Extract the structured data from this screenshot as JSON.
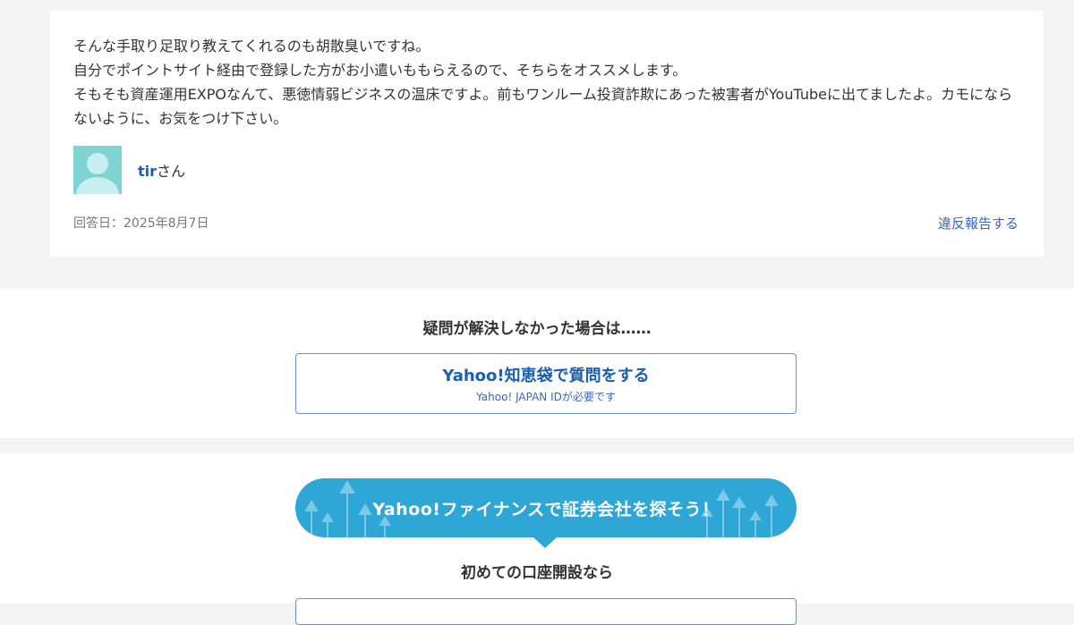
{
  "answer": {
    "lines": [
      "そんな手取り足取り教えてくれるのも胡散臭いですね。",
      "自分でポイントサイト経由で登録した方がお小遣いももらえるので、そちらをオススメします。",
      "そもそも資産運用EXPOなんて、悪徳情弱ビジネスの温床ですよ。前もワンルーム投資詐欺にあった被害者がYouTubeに出てましたよ。カモにならないように、お気をつけ下さい。"
    ],
    "author_id": "tir",
    "author_suffix": "さん",
    "date": "回答日：2025年8月7日",
    "report_label": "違反報告する"
  },
  "resolve": {
    "title": "疑問が解決しなかった場合は……",
    "ask_label": "Yahoo!知恵袋で質問をする",
    "ask_sub": "Yahoo! JAPAN IDが必要です"
  },
  "finance": {
    "banner_text": "Yahoo!ファイナンスで証券会社を探そう！",
    "subtitle": "初めての口座開設なら"
  },
  "colors": {
    "link": "#3867b7",
    "banner": "#2ea6d6",
    "avatar": "#7fd3d3"
  }
}
